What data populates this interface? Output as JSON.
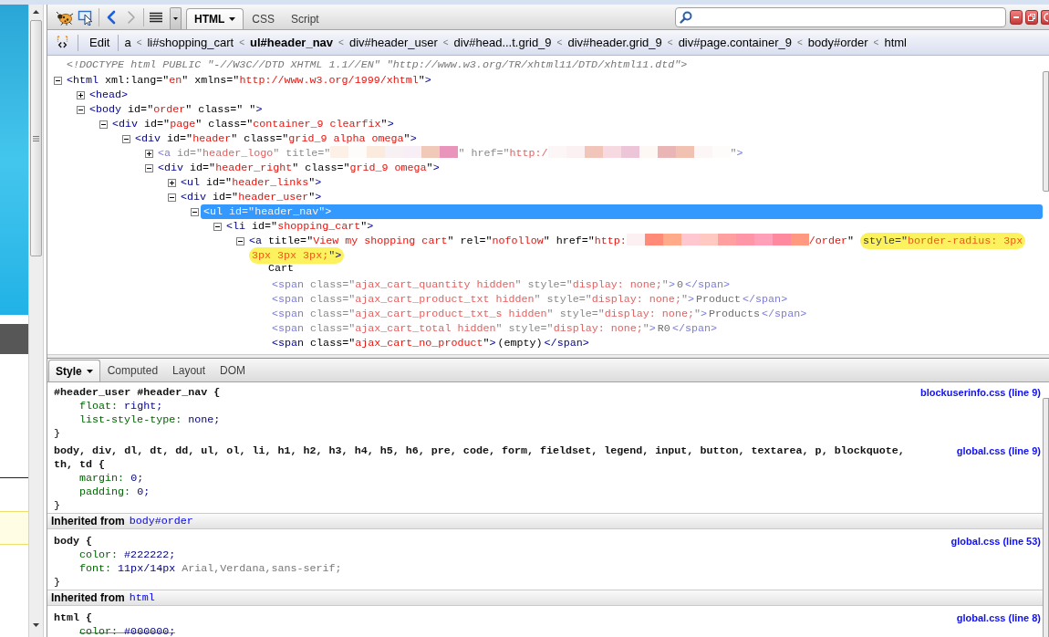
{
  "toolbar": {
    "nav_buttons": [
      {
        "kind": "back",
        "disabled": false
      },
      {
        "kind": "forward",
        "disabled": true
      }
    ],
    "tabs": [
      {
        "label": "HTML",
        "selected": true
      },
      {
        "label": "CSS",
        "selected": false
      },
      {
        "label": "Script",
        "selected": false
      }
    ]
  },
  "breadcrumb_bar": {
    "edit_button": "Edit",
    "items": [
      {
        "label": "a",
        "selected": false,
        "separator": "<"
      },
      {
        "label": "li#shopping_cart",
        "selected": false,
        "separator": "<"
      },
      {
        "label": "ul#header_nav",
        "selected": true,
        "separator": "<"
      },
      {
        "label": "div#header_user",
        "selected": false,
        "separator": "<"
      },
      {
        "label": "div#head...t.grid_9",
        "selected": false,
        "separator": "<"
      },
      {
        "label": "div#header.grid_9",
        "selected": false,
        "separator": "<"
      },
      {
        "label": "div#page.container_9",
        "selected": false,
        "separator": "<"
      },
      {
        "label": "body#order",
        "selected": false,
        "separator": "<"
      },
      {
        "label": "html",
        "selected": false
      }
    ]
  },
  "html_tree": [
    {
      "kind": "doctype",
      "text": "<!DOCTYPE html PUBLIC \"-//W3C//DTD XHTML 1.1//EN\" \"http://www.w3.org/TR/xhtml11/DTD/xhtml11.dtd\">"
    },
    {
      "kind": "element",
      "expanded": true,
      "selected": false,
      "hidden": false,
      "tokens": [
        {
          "kind": "tag",
          "text": "<html"
        },
        {
          "kind": "attr",
          "text": " xml:lang=\""
        },
        {
          "kind": "value",
          "text": "en"
        },
        {
          "kind": "attr",
          "text": "\" xmlns=\""
        },
        {
          "kind": "value",
          "text": "http://www.w3.org/1999/xhtml"
        },
        {
          "kind": "attr",
          "text": "\""
        },
        {
          "kind": "tag",
          "text": ">"
        }
      ],
      "children": [
        {
          "kind": "element",
          "expanded": false,
          "selected": false,
          "hidden": false,
          "tokens": [
            {
              "kind": "tag",
              "text": "<head>"
            }
          ]
        },
        {
          "kind": "element",
          "expanded": true,
          "selected": false,
          "hidden": false,
          "tokens": [
            {
              "kind": "tag",
              "text": "<body"
            },
            {
              "kind": "attr",
              "text": " id=\""
            },
            {
              "kind": "value",
              "text": "order"
            },
            {
              "kind": "attr",
              "text": "\" class=\" \""
            },
            {
              "kind": "tag",
              "text": ">"
            }
          ],
          "children": [
            {
              "kind": "element",
              "expanded": true,
              "selected": false,
              "hidden": false,
              "tokens": [
                {
                  "kind": "tag",
                  "text": "<div"
                },
                {
                  "kind": "attr",
                  "text": " id=\""
                },
                {
                  "kind": "value",
                  "text": "page"
                },
                {
                  "kind": "attr",
                  "text": "\" class=\""
                },
                {
                  "kind": "value",
                  "text": "container_9 clearfix"
                },
                {
                  "kind": "attr",
                  "text": "\""
                },
                {
                  "kind": "tag",
                  "text": ">"
                }
              ],
              "children": [
                {
                  "kind": "element",
                  "expanded": true,
                  "selected": false,
                  "hidden": false,
                  "tokens": [
                    {
                      "kind": "tag",
                      "text": "<div"
                    },
                    {
                      "kind": "attr",
                      "text": " id=\""
                    },
                    {
                      "kind": "value",
                      "text": "header"
                    },
                    {
                      "kind": "attr",
                      "text": "\" class=\""
                    },
                    {
                      "kind": "value",
                      "text": "grid_9 alpha omega"
                    },
                    {
                      "kind": "attr",
                      "text": "\""
                    },
                    {
                      "kind": "tag",
                      "text": ">"
                    }
                  ],
                  "children": [
                    {
                      "kind": "element",
                      "expanded": false,
                      "selected": false,
                      "hidden": true,
                      "tokens": [
                        {
                          "kind": "tag",
                          "text": "<a"
                        },
                        {
                          "kind": "attr",
                          "text": " id=\""
                        },
                        {
                          "kind": "value",
                          "text": "header_logo"
                        },
                        {
                          "kind": "attr",
                          "text": "\" title=\""
                        },
                        {
                          "kind": "redacted",
                          "tiles": [
                            {
                              "color": "#fdf1e7"
                            },
                            {
                              "color": "#fefcfb"
                            },
                            {
                              "color": "#fbeade"
                            },
                            {
                              "color": "#f7f1f4"
                            },
                            {
                              "color": "#f8eff6"
                            },
                            {
                              "color": "#f1c9b9"
                            },
                            {
                              "color": "#e994bb"
                            }
                          ]
                        },
                        {
                          "kind": "attr",
                          "text": "\" href=\""
                        },
                        {
                          "kind": "value",
                          "text": "http:/"
                        },
                        {
                          "kind": "redacted",
                          "tiles": [
                            {
                              "color": "#fdf6f6"
                            },
                            {
                              "color": "#fbf1f3"
                            },
                            {
                              "color": "#f1c5b9"
                            },
                            {
                              "color": "#f6d9e1"
                            },
                            {
                              "color": "#edc5d9"
                            },
                            {
                              "color": "#fdf8f4"
                            },
                            {
                              "color": "#e9b5b5"
                            },
                            {
                              "color": "#f1c1b1"
                            },
                            {
                              "color": "#fcf6f6"
                            },
                            {
                              "color": "#fefbfb"
                            }
                          ]
                        },
                        {
                          "kind": "attr",
                          "text": "\""
                        },
                        {
                          "kind": "tag",
                          "text": ">"
                        }
                      ]
                    },
                    {
                      "kind": "element",
                      "expanded": true,
                      "selected": false,
                      "hidden": false,
                      "tokens": [
                        {
                          "kind": "tag",
                          "text": "<div"
                        },
                        {
                          "kind": "attr",
                          "text": " id=\""
                        },
                        {
                          "kind": "value",
                          "text": "header_right"
                        },
                        {
                          "kind": "attr",
                          "text": "\" class=\""
                        },
                        {
                          "kind": "value",
                          "text": "grid_9 omega"
                        },
                        {
                          "kind": "attr",
                          "text": "\""
                        },
                        {
                          "kind": "tag",
                          "text": ">"
                        }
                      ],
                      "children": [
                        {
                          "kind": "element",
                          "expanded": false,
                          "selected": false,
                          "hidden": false,
                          "tokens": [
                            {
                              "kind": "tag",
                              "text": "<ul"
                            },
                            {
                              "kind": "attr",
                              "text": " id=\""
                            },
                            {
                              "kind": "value",
                              "text": "header_links"
                            },
                            {
                              "kind": "attr",
                              "text": "\""
                            },
                            {
                              "kind": "tag",
                              "text": ">"
                            }
                          ]
                        },
                        {
                          "kind": "element",
                          "expanded": true,
                          "selected": false,
                          "hidden": false,
                          "tokens": [
                            {
                              "kind": "tag",
                              "text": "<div"
                            },
                            {
                              "kind": "attr",
                              "text": " id=\""
                            },
                            {
                              "kind": "value",
                              "text": "header_user"
                            },
                            {
                              "kind": "attr",
                              "text": "\""
                            },
                            {
                              "kind": "tag",
                              "text": ">"
                            }
                          ],
                          "children": [
                            {
                              "kind": "element",
                              "expanded": true,
                              "selected": true,
                              "hidden": false,
                              "tokens": [
                                {
                                  "kind": "tag",
                                  "text": "<ul"
                                },
                                {
                                  "kind": "attr",
                                  "text": " id=\""
                                },
                                {
                                  "kind": "value",
                                  "text": "header_nav"
                                },
                                {
                                  "kind": "attr",
                                  "text": "\""
                                },
                                {
                                  "kind": "tag",
                                  "text": ">"
                                }
                              ],
                              "children": [
                                {
                                  "kind": "element",
                                  "expanded": true,
                                  "selected": false,
                                  "hidden": false,
                                  "tokens": [
                                    {
                                      "kind": "tag",
                                      "text": "<li"
                                    },
                                    {
                                      "kind": "attr",
                                      "text": " id=\""
                                    },
                                    {
                                      "kind": "value",
                                      "text": "shopping_cart"
                                    },
                                    {
                                      "kind": "attr",
                                      "text": "\""
                                    },
                                    {
                                      "kind": "tag",
                                      "text": ">"
                                    }
                                  ],
                                  "children": [
                                    {
                                      "kind": "element",
                                      "expanded": true,
                                      "selected": false,
                                      "hidden": false,
                                      "tokens": [
                                        {
                                          "kind": "tag",
                                          "text": "<a"
                                        },
                                        {
                                          "kind": "attr",
                                          "text": " title=\""
                                        },
                                        {
                                          "kind": "value",
                                          "text": "View my shopping cart"
                                        },
                                        {
                                          "kind": "attr",
                                          "text": "\" rel=\""
                                        },
                                        {
                                          "kind": "value",
                                          "text": "nofollow"
                                        },
                                        {
                                          "kind": "attr",
                                          "text": "\" href=\""
                                        },
                                        {
                                          "kind": "value",
                                          "text": "http:"
                                        },
                                        {
                                          "kind": "redacted",
                                          "tiles": [
                                            {
                                              "color": "#fdf0f3"
                                            },
                                            {
                                              "color": "#ff8a78"
                                            },
                                            {
                                              "color": "#ffaa88"
                                            },
                                            {
                                              "color": "#ffc8d0"
                                            },
                                            {
                                              "color": "#ffc8c0"
                                            },
                                            {
                                              "color": "#ff9f9f"
                                            },
                                            {
                                              "color": "#ff96a8"
                                            },
                                            {
                                              "color": "#ffa0b8"
                                            },
                                            {
                                              "color": "#ff8aa0"
                                            },
                                            {
                                              "color": "#ff9980"
                                            }
                                          ]
                                        },
                                        {
                                          "kind": "value",
                                          "text": "/order"
                                        },
                                        {
                                          "kind": "attr",
                                          "text": "\" "
                                        }
                                      ],
                                      "highlighted_tokens": [
                                        {
                                          "kind": "attr",
                                          "text": "style=\""
                                        },
                                        {
                                          "kind": "value",
                                          "text": "border-radius: 3px 3px 3px 3px;"
                                        },
                                        {
                                          "kind": "attr",
                                          "text": "\""
                                        },
                                        {
                                          "kind": "tag",
                                          "text": ">"
                                        }
                                      ],
                                      "children": [
                                        {
                                          "kind": "text",
                                          "text": "Cart"
                                        },
                                        {
                                          "kind": "inline",
                                          "selected": false,
                                          "hidden": true,
                                          "tokens": [
                                            {
                                              "kind": "tag",
                                              "text": "<span"
                                            },
                                            {
                                              "kind": "attr",
                                              "text": " class=\""
                                            },
                                            {
                                              "kind": "value",
                                              "text": "ajax_cart_quantity hidden"
                                            },
                                            {
                                              "kind": "attr",
                                              "text": "\" style=\""
                                            },
                                            {
                                              "kind": "value",
                                              "text": "display: none;"
                                            },
                                            {
                                              "kind": "attr",
                                              "text": "\""
                                            },
                                            {
                                              "kind": "tag",
                                              "text": ">"
                                            },
                                            {
                                              "kind": "text",
                                              "text": "0"
                                            },
                                            {
                                              "kind": "tag",
                                              "text": "</span>"
                                            }
                                          ]
                                        },
                                        {
                                          "kind": "inline",
                                          "selected": false,
                                          "hidden": true,
                                          "tokens": [
                                            {
                                              "kind": "tag",
                                              "text": "<span"
                                            },
                                            {
                                              "kind": "attr",
                                              "text": " class=\""
                                            },
                                            {
                                              "kind": "value",
                                              "text": "ajax_cart_product_txt hidden"
                                            },
                                            {
                                              "kind": "attr",
                                              "text": "\" style=\""
                                            },
                                            {
                                              "kind": "value",
                                              "text": "display: none;"
                                            },
                                            {
                                              "kind": "attr",
                                              "text": "\""
                                            },
                                            {
                                              "kind": "tag",
                                              "text": ">"
                                            },
                                            {
                                              "kind": "text",
                                              "text": "Product"
                                            },
                                            {
                                              "kind": "tag",
                                              "text": "</span>"
                                            }
                                          ]
                                        },
                                        {
                                          "kind": "inline",
                                          "selected": false,
                                          "hidden": true,
                                          "tokens": [
                                            {
                                              "kind": "tag",
                                              "text": "<span"
                                            },
                                            {
                                              "kind": "attr",
                                              "text": " class=\""
                                            },
                                            {
                                              "kind": "value",
                                              "text": "ajax_cart_product_txt_s hidden"
                                            },
                                            {
                                              "kind": "attr",
                                              "text": "\" style=\""
                                            },
                                            {
                                              "kind": "value",
                                              "text": "display: none;"
                                            },
                                            {
                                              "kind": "attr",
                                              "text": "\""
                                            },
                                            {
                                              "kind": "tag",
                                              "text": ">"
                                            },
                                            {
                                              "kind": "text",
                                              "text": "Products"
                                            },
                                            {
                                              "kind": "tag",
                                              "text": "</span>"
                                            }
                                          ]
                                        },
                                        {
                                          "kind": "inline",
                                          "selected": false,
                                          "hidden": true,
                                          "tokens": [
                                            {
                                              "kind": "tag",
                                              "text": "<span"
                                            },
                                            {
                                              "kind": "attr",
                                              "text": " class=\""
                                            },
                                            {
                                              "kind": "value",
                                              "text": "ajax_cart_total hidden"
                                            },
                                            {
                                              "kind": "attr",
                                              "text": "\" style=\""
                                            },
                                            {
                                              "kind": "value",
                                              "text": "display: none;"
                                            },
                                            {
                                              "kind": "attr",
                                              "text": "\""
                                            },
                                            {
                                              "kind": "tag",
                                              "text": ">"
                                            },
                                            {
                                              "kind": "text",
                                              "text": "R0"
                                            },
                                            {
                                              "kind": "tag",
                                              "text": "</span>"
                                            }
                                          ]
                                        },
                                        {
                                          "kind": "inline",
                                          "selected": false,
                                          "hidden": false,
                                          "tokens": [
                                            {
                                              "kind": "tag",
                                              "text": "<span"
                                            },
                                            {
                                              "kind": "attr",
                                              "text": " class=\""
                                            },
                                            {
                                              "kind": "value",
                                              "text": "ajax_cart_no_product"
                                            },
                                            {
                                              "kind": "attr",
                                              "text": "\""
                                            },
                                            {
                                              "kind": "tag",
                                              "text": ">"
                                            },
                                            {
                                              "kind": "text",
                                              "text": "(empty)"
                                            },
                                            {
                                              "kind": "tag",
                                              "text": "</span>"
                                            }
                                          ]
                                        }
                                      ]
                                    }
                                  ]
                                }
                              ]
                            }
                          ]
                        }
                      ]
                    }
                  ]
                }
              ]
            }
          ]
        }
      ]
    }
  ],
  "side_panel": {
    "tabs": [
      {
        "label": "Style",
        "selected": true
      },
      {
        "label": "Computed",
        "selected": false
      },
      {
        "label": "Layout",
        "selected": false
      },
      {
        "label": "DOM",
        "selected": false
      }
    ],
    "styles": [
      {
        "kind": "rule",
        "selector": "#header_user #header_nav {",
        "source": "blockuserinfo.css (line 9)",
        "properties": [
          {
            "name": "float:",
            "value": "right;",
            "overridden": false
          },
          {
            "name": "list-style-type:",
            "value": "none;",
            "overridden": false
          }
        ],
        "close": "}"
      },
      {
        "kind": "rule",
        "selector": "body, div, dl, dt, dd, ul, ol, li, h1, h2, h3, h4, h5, h6, pre, code, form, fieldset, legend, input, button, textarea, p, blockquote, th, td {",
        "source": "global.css (line 9)",
        "properties": [
          {
            "name": "margin:",
            "value": "0;",
            "overridden": false
          },
          {
            "name": "padding:",
            "value": "0;",
            "overridden": false
          }
        ],
        "close": "}"
      },
      {
        "kind": "inherited",
        "label": "Inherited from",
        "element": "body#order"
      },
      {
        "kind": "rule",
        "selector": "body {",
        "source": "global.css (line 53)",
        "properties": [
          {
            "name": "color:",
            "value": "#222222;",
            "overridden": false
          },
          {
            "name": "font:",
            "value": "11px/14px",
            "font_family": "Arial,Verdana,sans-serif;",
            "overridden": false
          }
        ],
        "close": "}"
      },
      {
        "kind": "inherited",
        "label": "Inherited from",
        "element": "html"
      },
      {
        "kind": "rule",
        "selector": "html {",
        "source": "global.css (line 8)",
        "properties": [
          {
            "name": "color:",
            "value": "#000000;",
            "overridden": true
          }
        ]
      }
    ]
  }
}
